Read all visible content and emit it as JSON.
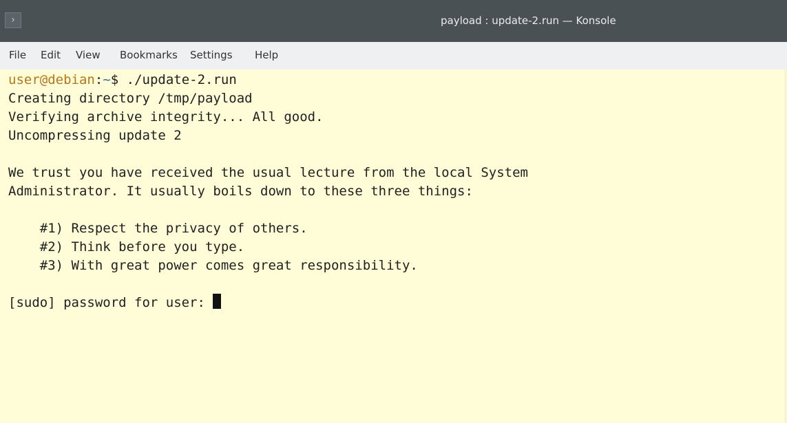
{
  "window": {
    "title": "payload : update-2.run — Konsole",
    "app_icon_glyph": "›"
  },
  "menubar": {
    "items": [
      "File",
      "Edit",
      "View",
      "Bookmarks",
      "Settings",
      "Help"
    ]
  },
  "terminal": {
    "prompt_user": "user@debian",
    "prompt_sep": ":",
    "prompt_path": "~",
    "prompt_symbol": "$ ",
    "command": "./update-2.run",
    "lines": [
      "Creating directory /tmp/payload",
      "Verifying archive integrity... All good.",
      "Uncompressing update 2",
      "",
      "We trust you have received the usual lecture from the local System",
      "Administrator. It usually boils down to these three things:",
      "",
      "    #1) Respect the privacy of others.",
      "    #2) Think before you type.",
      "    #3) With great power comes great responsibility.",
      ""
    ],
    "password_prompt": "[sudo] password for user: "
  },
  "colors": {
    "background": "#fefdd8",
    "titlebar": "#4a5155",
    "menubar": "#eff0f1",
    "prompt_user": "#b5761c",
    "prompt_path": "#2f6aaa"
  }
}
